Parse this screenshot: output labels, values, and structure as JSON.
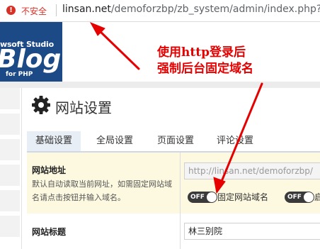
{
  "browser": {
    "security_label": "不安全",
    "url_host": "linsan.net",
    "url_path": "/demoforzbp/zb_system/admin/index.php?a"
  },
  "brand": {
    "studio": "wsoft Studio",
    "blog": "Blog",
    "for_php": "for PHP"
  },
  "annotation": {
    "line1": "使用http登录后",
    "line2": "强制后台固定域名",
    "color": "#e60000"
  },
  "page": {
    "title": "网站设置",
    "icon": "gear-icon"
  },
  "tabs": [
    {
      "label": "基础设置",
      "active": true
    },
    {
      "label": "全局设置",
      "active": false
    },
    {
      "label": "页面设置",
      "active": false
    },
    {
      "label": "评论设置",
      "active": false
    }
  ],
  "form": {
    "site_url": {
      "label": "网站地址",
      "hint": "默认自动读取当前网址，如需固定网站域名请点击按钮并输入域名。",
      "value": "http://linsan.net/demoforzbp/",
      "toggle1_text": "OFF",
      "toggle1_label": "固定网站域名",
      "toggle2_text": "OFF",
      "toggle2_label": "启"
    },
    "site_title": {
      "label": "网站标题",
      "value": "林三别院"
    }
  },
  "colors": {
    "brand_navy": "#1b4a87",
    "highlight_row": "#fdf9e0",
    "warning_red": "#d93025"
  }
}
